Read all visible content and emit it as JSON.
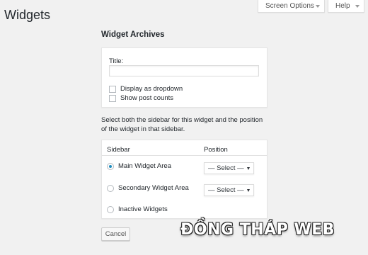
{
  "page": {
    "title": "Widgets"
  },
  "header": {
    "screen_options_label": "Screen Options",
    "help_label": "Help"
  },
  "widget": {
    "heading": "Widget Archives",
    "title_label": "Title:",
    "title_value": "",
    "checkboxes": [
      {
        "label": "Display as dropdown",
        "checked": false
      },
      {
        "label": "Show post counts",
        "checked": false
      }
    ],
    "instructions": "Select both the sidebar for this widget and the position of the widget in that sidebar."
  },
  "sidebar_table": {
    "col_sidebar": "Sidebar",
    "col_position": "Position",
    "rows": [
      {
        "label": "Main Widget Area",
        "selected": true,
        "position": "— Select —"
      },
      {
        "label": "Secondary Widget Area",
        "selected": false,
        "position": "— Select —"
      },
      {
        "label": "Inactive Widgets",
        "selected": false
      }
    ]
  },
  "actions": {
    "cancel_label": "Cancel"
  },
  "watermark": "ĐỒNG THÁP WEB",
  "colors": {
    "accent": "#1e8cbe",
    "background": "#f1f1f1"
  }
}
